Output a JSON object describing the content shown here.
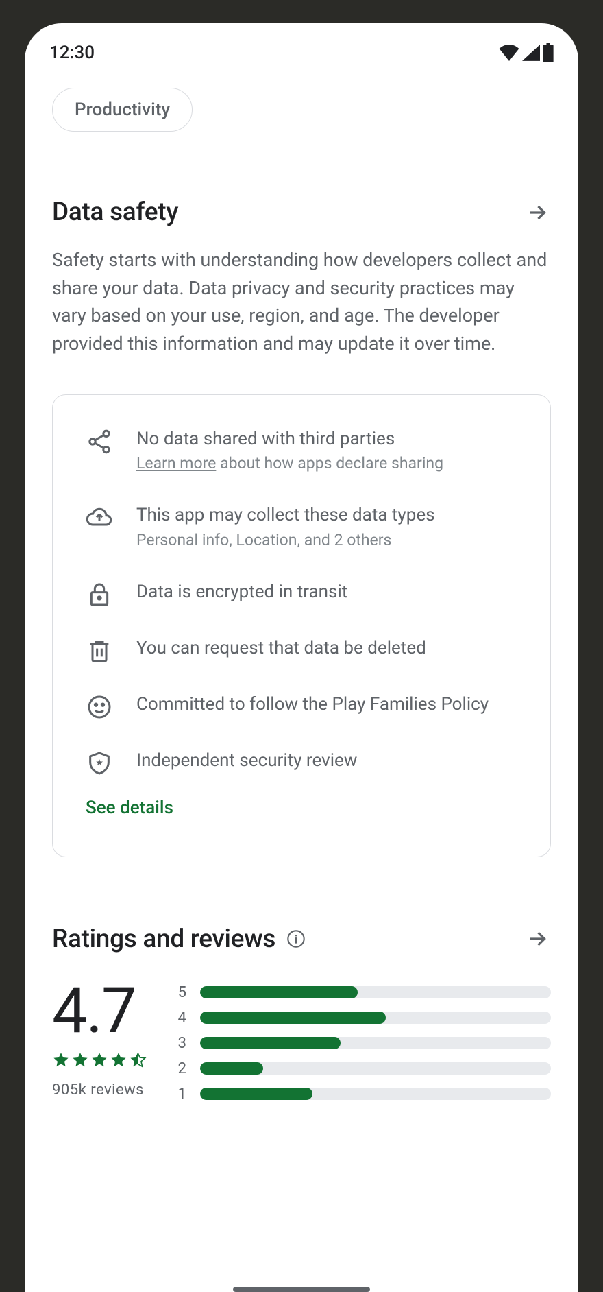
{
  "status_bar": {
    "time": "12:30"
  },
  "chip": {
    "label": "Productivity"
  },
  "data_safety": {
    "title": "Data safety",
    "description": "Safety starts with understanding how developers collect and share your data. Data privacy and security practices may vary based on your use, region, and age. The developer provided this information and may update it over time.",
    "items": [
      {
        "icon": "share",
        "title": "No data shared with third parties",
        "sub_link": "Learn more",
        "sub_rest": " about how apps declare sharing"
      },
      {
        "icon": "cloud",
        "title": "This app may collect these data types",
        "sub": "Personal info, Location, and 2 others"
      },
      {
        "icon": "lock",
        "title": "Data is encrypted in transit"
      },
      {
        "icon": "trash",
        "title": "You can request that data be deleted"
      },
      {
        "icon": "face",
        "title": "Committed to follow the Play Families Policy"
      },
      {
        "icon": "shield",
        "title": "Independent security review"
      }
    ],
    "see_details": "See details"
  },
  "ratings": {
    "title": "Ratings and reviews",
    "score": "4.7",
    "stars": 4.5,
    "review_count": "905k  reviews",
    "bars": [
      {
        "label": "5",
        "pct": 45
      },
      {
        "label": "4",
        "pct": 53
      },
      {
        "label": "3",
        "pct": 40
      },
      {
        "label": "2",
        "pct": 18
      },
      {
        "label": "1",
        "pct": 32
      }
    ]
  },
  "colors": {
    "accent": "#137333"
  }
}
